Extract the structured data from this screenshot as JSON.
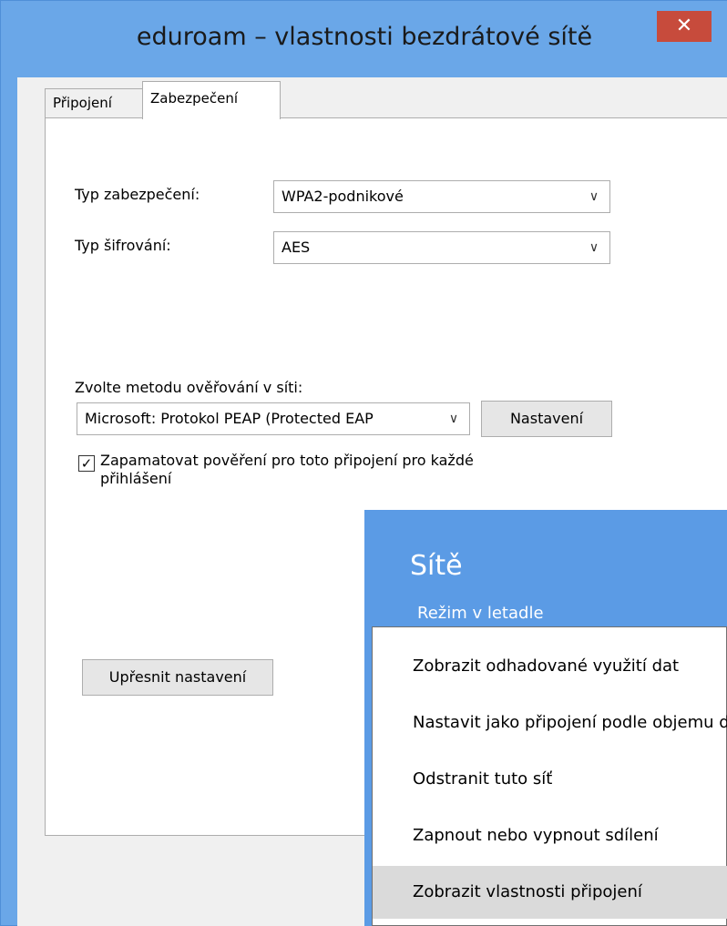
{
  "window": {
    "title": "eduroam – vlastnosti bezdrátové sítě",
    "close_glyph": "✕"
  },
  "tabs": [
    {
      "label": "Připojení",
      "active": false
    },
    {
      "label": "Zabezpečení",
      "active": true
    }
  ],
  "security": {
    "type_label": "Typ zabezpečení:",
    "type_value": "WPA2-podnikové",
    "encryption_label": "Typ šifrování:",
    "encryption_value": "AES",
    "auth_method_label": "Zvolte metodu ověřování v síti:",
    "auth_method_value": "Microsoft: Protokol PEAP (Protected EAP",
    "settings_button": "Nastavení",
    "remember_label_line1": "Zapamatovat pověření pro toto připojení pro každé",
    "remember_label_line2": "přihlášení",
    "remember_checked": true,
    "advanced_button": "Upřesnit nastavení"
  },
  "flyout": {
    "title": "Sítě",
    "airplane_mode": "Režim v letadle",
    "menu": [
      {
        "label": "Zobrazit odhadované využití dat"
      },
      {
        "label": "Nastavit jako připojení podle objemu dat"
      },
      {
        "label": "Odstranit tuto síť"
      },
      {
        "label": "Zapnout nebo vypnout sdílení"
      },
      {
        "label": "Zobrazit vlastnosti připojení",
        "highlighted": true
      }
    ]
  },
  "icons": {
    "chevron": "chevron-down-icon",
    "check": "checkmark-icon",
    "close": "close-icon"
  }
}
